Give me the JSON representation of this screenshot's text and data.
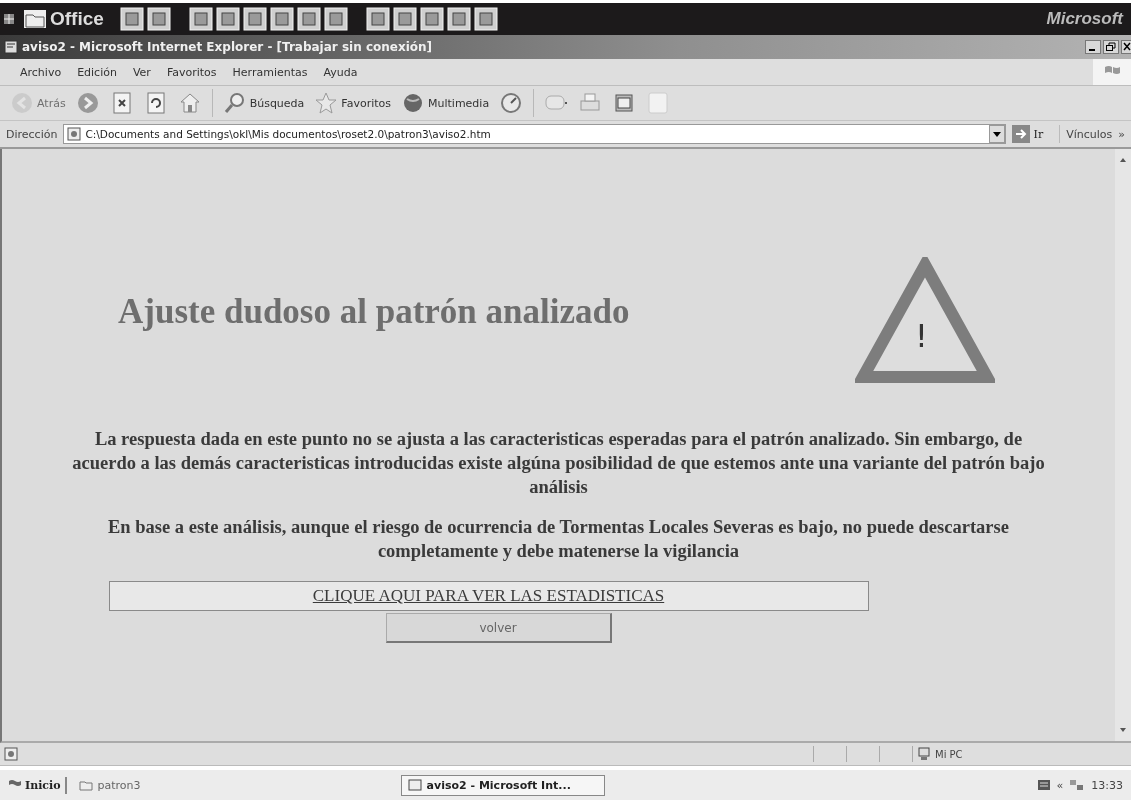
{
  "office_bar": {
    "title": "Office",
    "brand": "Microsoft"
  },
  "window": {
    "title": "aviso2 - Microsoft Internet Explorer - [Trabajar sin conexión]"
  },
  "menu": [
    "Archivo",
    "Edición",
    "Ver",
    "Favoritos",
    "Herramientas",
    "Ayuda"
  ],
  "toolbar": [
    {
      "kind": "back",
      "label": "Atrás",
      "disabled": true
    },
    {
      "kind": "forward",
      "disabled": false
    },
    {
      "kind": "stop",
      "disabled": false
    },
    {
      "kind": "refresh",
      "disabled": false
    },
    {
      "kind": "home",
      "disabled": false
    },
    {
      "kind": "search",
      "label": "Búsqueda",
      "disabled": false
    },
    {
      "kind": "favorites",
      "label": "Favoritos",
      "disabled": false
    },
    {
      "kind": "media",
      "label": "Multimedia",
      "disabled": false
    },
    {
      "kind": "history",
      "disabled": false
    },
    {
      "kind": "mail",
      "disabled": false
    },
    {
      "kind": "print",
      "disabled": false
    },
    {
      "kind": "edit",
      "disabled": false
    },
    {
      "kind": "blank",
      "disabled": false
    }
  ],
  "address_bar": {
    "label": "Dirección",
    "value": "C:\\Documents and Settings\\okl\\Mis documentos\\roset2.0\\patron3\\aviso2.htm",
    "go": "Ir",
    "links": "Vínculos",
    "more": "»"
  },
  "page": {
    "heading": "Ajuste dudoso al patrón analizado",
    "warning_symbol": "!",
    "paragraphs": [
      "La respuesta dada en este punto no se ajusta a las caracteristicas esperadas para el patrón analizado. Sin embargo, de acuerdo a las demás caracteristicas introducidas existe algúna posibilidad de que estemos ante una variante del patrón bajo análisis",
      "En base a este análisis, aunque el riesgo de ocurrencia de Tormentas Locales Severas es bajo, no puede descartarse completamente y debe matenerse la vigilancia"
    ],
    "link": "CLIQUE AQUI PARA VER LAS ESTADISTICAS",
    "button": "volver"
  },
  "status_bar": {
    "zone": "Mi PC"
  },
  "taskbar": {
    "start": "Inicio",
    "items": [
      {
        "label": "patron3",
        "selected": false
      },
      {
        "label": "aviso2 - Microsoft Int...",
        "selected": true
      }
    ],
    "tray_expand": "«",
    "clock": "13:33"
  }
}
